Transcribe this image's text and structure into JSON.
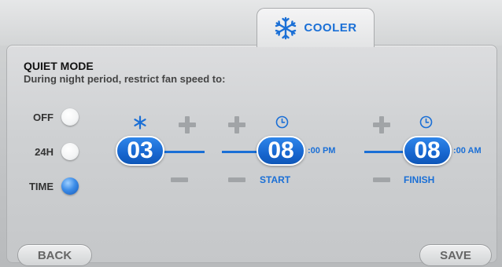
{
  "tab": {
    "label": "COOLER",
    "icon": "snowflake-icon"
  },
  "quiet_mode": {
    "title": "QUIET MODE",
    "description": "During night period, restrict fan speed to:"
  },
  "options": [
    {
      "label": "OFF",
      "selected": false
    },
    {
      "label": "24H",
      "selected": false
    },
    {
      "label": "TIME",
      "selected": true
    }
  ],
  "fan_speed": {
    "value": "03",
    "icon": "fan-icon"
  },
  "start": {
    "hour": "08",
    "suffix": ":00 PM",
    "label": "START",
    "icon": "clock-icon"
  },
  "finish": {
    "hour": "08",
    "suffix": ":00 AM",
    "label": "FINISH",
    "icon": "clock-icon"
  },
  "buttons": {
    "back": "BACK",
    "save": "SAVE"
  },
  "colors": {
    "accent": "#1a6fd6",
    "control_gray": "#a1a4a7"
  }
}
